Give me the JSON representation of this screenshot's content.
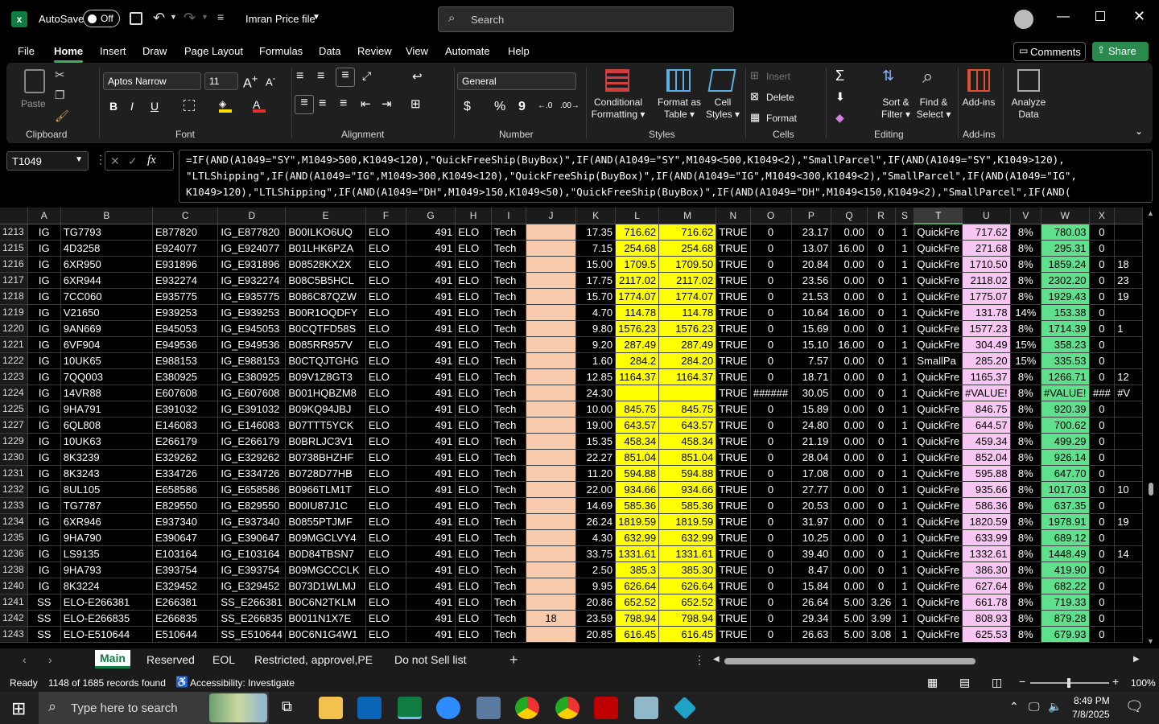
{
  "titlebar": {
    "autosave_label": "AutoSave",
    "autosave_state": "Off",
    "file_name": "Imran Price file",
    "search_placeholder": "Search"
  },
  "ribbon_tabs": [
    "File",
    "Home",
    "Insert",
    "Draw",
    "Page Layout",
    "Formulas",
    "Data",
    "Review",
    "View",
    "Automate",
    "Help"
  ],
  "active_tab": "Home",
  "comments_label": "Comments",
  "share_label": "Share",
  "ribbon": {
    "clipboard": {
      "paste": "Paste",
      "label": "Clipboard"
    },
    "font": {
      "name": "Aptos Narrow",
      "size": "11",
      "label": "Font",
      "bold": "B",
      "italic": "I",
      "underline": "U"
    },
    "alignment": {
      "label": "Alignment"
    },
    "number": {
      "format": "General",
      "label": "Number",
      "currency": "$",
      "percent": "%",
      "comma": "9"
    },
    "styles": {
      "conditional": "Conditional",
      "formatting": "Formatting",
      "format_as": "Format as",
      "table": "Table",
      "cell": "Cell",
      "styles_btn": "Styles",
      "label": "Styles"
    },
    "cells": {
      "insert": "Insert",
      "delete": "Delete",
      "format": "Format",
      "label": "Cells"
    },
    "editing": {
      "sort1": "Sort &",
      "sort2": "Filter",
      "find1": "Find &",
      "find2": "Select",
      "label": "Editing"
    },
    "addins": {
      "addins": "Add-ins",
      "label": "Add-ins"
    },
    "analyze": {
      "l1": "Analyze",
      "l2": "Data"
    }
  },
  "formula_bar": {
    "name_box": "T1049",
    "fx": "fx",
    "formula_lines": [
      "=IF(AND(A1049=\"SY\",M1049>500,K1049<120),\"QuickFreeShip(BuyBox)\",IF(AND(A1049=\"SY\",M1049<500,K1049<2),\"SmallParcel\",IF(AND(A1049=\"SY\",K1049>120),",
      "\"LTLShipping\",IF(AND(A1049=\"IG\",M1049>300,K1049<120),\"QuickFreeShip(BuyBox)\",IF(AND(A1049=\"IG\",M1049<300,K1049<2),\"SmallParcel\",IF(AND(A1049=\"IG\",",
      "K1049>120),\"LTLShipping\",IF(AND(A1049=\"DH\",M1049>150,K1049<50),\"QuickFreeShip(BuyBox)\",IF(AND(A1049=\"DH\",M1049<150,K1049<2),\"SmallParcel\",IF(AND("
    ]
  },
  "columns": [
    "A",
    "B",
    "C",
    "D",
    "E",
    "F",
    "G",
    "H",
    "I",
    "J",
    "K",
    "L",
    "M",
    "N",
    "O",
    "P",
    "Q",
    "R",
    "S",
    "T",
    "U",
    "V",
    "W",
    "X"
  ],
  "selected_column": "T",
  "rows": [
    [
      "1213",
      "IG",
      "TG7793",
      "E877820",
      "IG_E877820",
      "B00ILKO6UQ",
      "ELO",
      "491",
      "ELO",
      "Tech",
      "",
      "17.35",
      "716.62",
      "716.62",
      "TRUE",
      "0",
      "23.17",
      "0.00",
      "0",
      "1",
      "QuickFre",
      "717.62",
      "8%",
      "780.03",
      "0",
      ""
    ],
    [
      "1215",
      "IG",
      "4D3258",
      "E924077",
      "IG_E924077",
      "B01LHK6PZA",
      "ELO",
      "491",
      "ELO",
      "Tech",
      "",
      "7.15",
      "254.68",
      "254.68",
      "TRUE",
      "0",
      "13.07",
      "16.00",
      "0",
      "1",
      "QuickFre",
      "271.68",
      "8%",
      "295.31",
      "0",
      ""
    ],
    [
      "1216",
      "IG",
      "6XR950",
      "E931896",
      "IG_E931896",
      "B08528KX2X",
      "ELO",
      "491",
      "ELO",
      "Tech",
      "",
      "15.00",
      "1709.5",
      "1709.50",
      "TRUE",
      "0",
      "20.84",
      "0.00",
      "0",
      "1",
      "QuickFre",
      "1710.50",
      "8%",
      "1859.24",
      "0",
      "18"
    ],
    [
      "1217",
      "IG",
      "6XR944",
      "E932274",
      "IG_E932274",
      "B08C5B5HCL",
      "ELO",
      "491",
      "ELO",
      "Tech",
      "",
      "17.75",
      "2117.02",
      "2117.02",
      "TRUE",
      "0",
      "23.56",
      "0.00",
      "0",
      "1",
      "QuickFre",
      "2118.02",
      "8%",
      "2302.20",
      "0",
      "23"
    ],
    [
      "1218",
      "IG",
      "7CC060",
      "E935775",
      "IG_E935775",
      "B086C87QZW",
      "ELO",
      "491",
      "ELO",
      "Tech",
      "",
      "15.70",
      "1774.07",
      "1774.07",
      "TRUE",
      "0",
      "21.53",
      "0.00",
      "0",
      "1",
      "QuickFre",
      "1775.07",
      "8%",
      "1929.43",
      "0",
      "19"
    ],
    [
      "1219",
      "IG",
      "V21650",
      "E939253",
      "IG_E939253",
      "B00R1OQDFY",
      "ELO",
      "491",
      "ELO",
      "Tech",
      "",
      "4.70",
      "114.78",
      "114.78",
      "TRUE",
      "0",
      "10.64",
      "16.00",
      "0",
      "1",
      "QuickFre",
      "131.78",
      "14%",
      "153.38",
      "0",
      ""
    ],
    [
      "1220",
      "IG",
      "9AN669",
      "E945053",
      "IG_E945053",
      "B0CQTFD58S",
      "ELO",
      "491",
      "ELO",
      "Tech",
      "",
      "9.80",
      "1576.23",
      "1576.23",
      "TRUE",
      "0",
      "15.69",
      "0.00",
      "0",
      "1",
      "QuickFre",
      "1577.23",
      "8%",
      "1714.39",
      "0",
      "1"
    ],
    [
      "1221",
      "IG",
      "6VF904",
      "E949536",
      "IG_E949536",
      "B085RR957V",
      "ELO",
      "491",
      "ELO",
      "Tech",
      "",
      "9.20",
      "287.49",
      "287.49",
      "TRUE",
      "0",
      "15.10",
      "16.00",
      "0",
      "1",
      "QuickFre",
      "304.49",
      "15%",
      "358.23",
      "0",
      ""
    ],
    [
      "1222",
      "IG",
      "10UK65",
      "E988153",
      "IG_E988153",
      "B0CTQJTGHG",
      "ELO",
      "491",
      "ELO",
      "Tech",
      "",
      "1.60",
      "284.2",
      "284.20",
      "TRUE",
      "0",
      "7.57",
      "0.00",
      "0",
      "1",
      "SmallPa",
      "285.20",
      "15%",
      "335.53",
      "0",
      ""
    ],
    [
      "1223",
      "IG",
      "7QQ003",
      "E380925",
      "IG_E380925",
      "B09V1Z8GT3",
      "ELO",
      "491",
      "ELO",
      "Tech",
      "",
      "12.85",
      "1164.37",
      "1164.37",
      "TRUE",
      "0",
      "18.71",
      "0.00",
      "0",
      "1",
      "QuickFre",
      "1165.37",
      "8%",
      "1266.71",
      "0",
      "12"
    ],
    [
      "1224",
      "IG",
      "14VR88",
      "E607608",
      "IG_E607608",
      "B001HQBZM8",
      "ELO",
      "491",
      "ELO",
      "Tech",
      "",
      "24.30",
      "",
      "",
      "TRUE",
      "######",
      "30.05",
      "0.00",
      "0",
      "1",
      "QuickFre",
      "#VALUE!",
      "8%",
      "#VALUE!",
      "###",
      "#V"
    ],
    [
      "1225",
      "IG",
      "9HA791",
      "E391032",
      "IG_E391032",
      "B09KQ94JBJ",
      "ELO",
      "491",
      "ELO",
      "Tech",
      "",
      "10.00",
      "845.75",
      "845.75",
      "TRUE",
      "0",
      "15.89",
      "0.00",
      "0",
      "1",
      "QuickFre",
      "846.75",
      "8%",
      "920.39",
      "0",
      ""
    ],
    [
      "1227",
      "IG",
      "6QL808",
      "E146083",
      "IG_E146083",
      "B07TTT5YCK",
      "ELO",
      "491",
      "ELO",
      "Tech",
      "",
      "19.00",
      "643.57",
      "643.57",
      "TRUE",
      "0",
      "24.80",
      "0.00",
      "0",
      "1",
      "QuickFre",
      "644.57",
      "8%",
      "700.62",
      "0",
      ""
    ],
    [
      "1229",
      "IG",
      "10UK63",
      "E266179",
      "IG_E266179",
      "B0BRLJC3V1",
      "ELO",
      "491",
      "ELO",
      "Tech",
      "",
      "15.35",
      "458.34",
      "458.34",
      "TRUE",
      "0",
      "21.19",
      "0.00",
      "0",
      "1",
      "QuickFre",
      "459.34",
      "8%",
      "499.29",
      "0",
      ""
    ],
    [
      "1230",
      "IG",
      "8K3239",
      "E329262",
      "IG_E329262",
      "B0738BHZHF",
      "ELO",
      "491",
      "ELO",
      "Tech",
      "",
      "22.27",
      "851.04",
      "851.04",
      "TRUE",
      "0",
      "28.04",
      "0.00",
      "0",
      "1",
      "QuickFre",
      "852.04",
      "8%",
      "926.14",
      "0",
      ""
    ],
    [
      "1231",
      "IG",
      "8K3243",
      "E334726",
      "IG_E334726",
      "B0728D77HB",
      "ELO",
      "491",
      "ELO",
      "Tech",
      "",
      "11.20",
      "594.88",
      "594.88",
      "TRUE",
      "0",
      "17.08",
      "0.00",
      "0",
      "1",
      "QuickFre",
      "595.88",
      "8%",
      "647.70",
      "0",
      ""
    ],
    [
      "1232",
      "IG",
      "8UL105",
      "E658586",
      "IG_E658586",
      "B0966TLM1T",
      "ELO",
      "491",
      "ELO",
      "Tech",
      "",
      "22.00",
      "934.66",
      "934.66",
      "TRUE",
      "0",
      "27.77",
      "0.00",
      "0",
      "1",
      "QuickFre",
      "935.66",
      "8%",
      "1017.03",
      "0",
      "10"
    ],
    [
      "1233",
      "IG",
      "TG7787",
      "E829550",
      "IG_E829550",
      "B00IU87J1C",
      "ELO",
      "491",
      "ELO",
      "Tech",
      "",
      "14.69",
      "585.36",
      "585.36",
      "TRUE",
      "0",
      "20.53",
      "0.00",
      "0",
      "1",
      "QuickFre",
      "586.36",
      "8%",
      "637.35",
      "0",
      ""
    ],
    [
      "1234",
      "IG",
      "6XR946",
      "E937340",
      "IG_E937340",
      "B0855PTJMF",
      "ELO",
      "491",
      "ELO",
      "Tech",
      "",
      "26.24",
      "1819.59",
      "1819.59",
      "TRUE",
      "0",
      "31.97",
      "0.00",
      "0",
      "1",
      "QuickFre",
      "1820.59",
      "8%",
      "1978.91",
      "0",
      "19"
    ],
    [
      "1235",
      "IG",
      "9HA790",
      "E390647",
      "IG_E390647",
      "B09MGCLVY4",
      "ELO",
      "491",
      "ELO",
      "Tech",
      "",
      "4.30",
      "632.99",
      "632.99",
      "TRUE",
      "0",
      "10.25",
      "0.00",
      "0",
      "1",
      "QuickFre",
      "633.99",
      "8%",
      "689.12",
      "0",
      ""
    ],
    [
      "1236",
      "IG",
      "LS9135",
      "E103164",
      "IG_E103164",
      "B0D84TBSN7",
      "ELO",
      "491",
      "ELO",
      "Tech",
      "",
      "33.75",
      "1331.61",
      "1331.61",
      "TRUE",
      "0",
      "39.40",
      "0.00",
      "0",
      "1",
      "QuickFre",
      "1332.61",
      "8%",
      "1448.49",
      "0",
      "14"
    ],
    [
      "1238",
      "IG",
      "9HA793",
      "E393754",
      "IG_E393754",
      "B09MGCCCLK",
      "ELO",
      "491",
      "ELO",
      "Tech",
      "",
      "2.50",
      "385.3",
      "385.30",
      "TRUE",
      "0",
      "8.47",
      "0.00",
      "0",
      "1",
      "QuickFre",
      "386.30",
      "8%",
      "419.90",
      "0",
      ""
    ],
    [
      "1240",
      "IG",
      "8K3224",
      "E329452",
      "IG_E329452",
      "B073D1WLMJ",
      "ELO",
      "491",
      "ELO",
      "Tech",
      "",
      "9.95",
      "626.64",
      "626.64",
      "TRUE",
      "0",
      "15.84",
      "0.00",
      "0",
      "1",
      "QuickFre",
      "627.64",
      "8%",
      "682.22",
      "0",
      ""
    ],
    [
      "1241",
      "SS",
      "ELO-E266381",
      "E266381",
      "SS_E266381",
      "B0C6N2TKLM",
      "ELO",
      "491",
      "ELO",
      "Tech",
      "",
      "20.86",
      "652.52",
      "652.52",
      "TRUE",
      "0",
      "26.64",
      "5.00",
      "3.26",
      "1",
      "QuickFre",
      "661.78",
      "8%",
      "719.33",
      "0",
      ""
    ],
    [
      "1242",
      "SS",
      "ELO-E266835",
      "E266835",
      "SS_E266835",
      "B0011N1X7E",
      "ELO",
      "491",
      "ELO",
      "Tech",
      "18",
      "23.59",
      "798.94",
      "798.94",
      "TRUE",
      "0",
      "29.34",
      "5.00",
      "3.99",
      "1",
      "QuickFre",
      "808.93",
      "8%",
      "879.28",
      "0",
      ""
    ],
    [
      "1243",
      "SS",
      "ELO-E510644",
      "E510644",
      "SS_E510644",
      "B0C6N1G4W1",
      "ELO",
      "491",
      "ELO",
      "Tech",
      "",
      "20.85",
      "616.45",
      "616.45",
      "TRUE",
      "0",
      "26.63",
      "5.00",
      "3.08",
      "1",
      "QuickFre",
      "625.53",
      "8%",
      "679.93",
      "0",
      ""
    ]
  ],
  "sheet_tabs": [
    "Main",
    "Reserved",
    "EOL",
    "Restricted, approvel,PE",
    "Do not Sell list"
  ],
  "active_sheet": "Main",
  "status": {
    "ready": "Ready",
    "records": "1148 of 1685 records found",
    "accessibility": "Accessibility: Investigate",
    "zoom": "100%"
  },
  "taskbar": {
    "search_placeholder": "Type here to search",
    "time": "8:49 PM",
    "date": "7/8/2025"
  },
  "colors": {
    "excel_green": "#107c41",
    "yellow": "#ffff00",
    "salmon": "#f8cbad",
    "pink": "#f8c6f2",
    "green": "#5fe08c"
  }
}
